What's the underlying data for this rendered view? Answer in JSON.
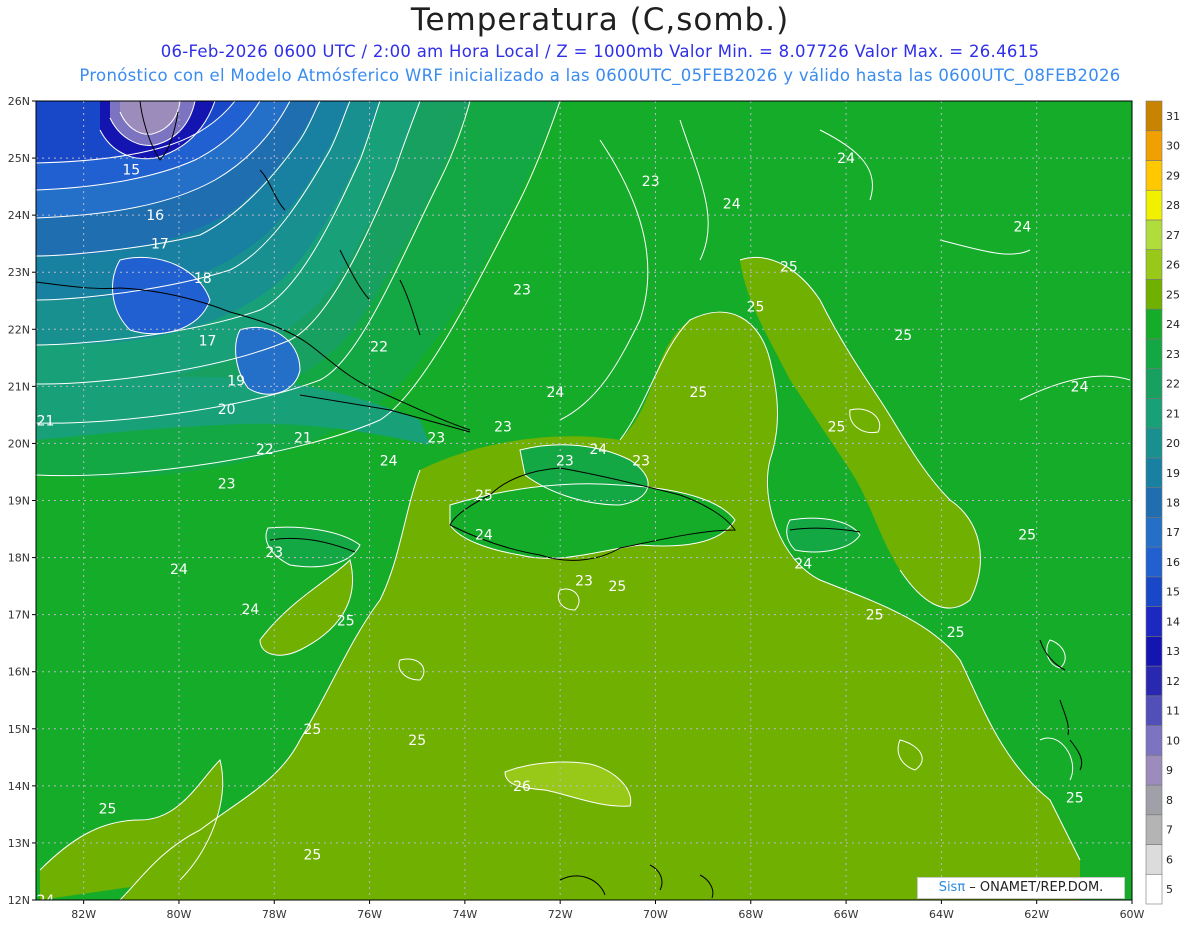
{
  "header": {
    "title": "Temperatura (C,somb.)",
    "subtitle1": "06-Feb-2026  0600 UTC / 2:00 am Hora Local / Z = 1000mb    Valor Min. = 8.07726  Valor Max. = 26.4615",
    "subtitle2": "Pronóstico con el Modelo Atmósferico WRF inicializado a las 0600UTC_05FEB2026 y válido hasta las  0600UTC_08FEB2026"
  },
  "credit": {
    "brand": "Sisπ",
    "text": " – ONAMET/REP.DOM."
  },
  "map": {
    "lat_labels": [
      "26N",
      "25N",
      "24N",
      "23N",
      "22N",
      "21N",
      "20N",
      "19N",
      "18N",
      "17N",
      "16N",
      "15N",
      "14N",
      "13N",
      "12N"
    ],
    "lon_labels": [
      "82W",
      "80W",
      "78W",
      "76W",
      "74W",
      "72W",
      "70W",
      "68W",
      "66W",
      "64W",
      "62W",
      "60W"
    ],
    "lat_range": [
      12,
      26
    ],
    "lon_range": [
      -83,
      -60
    ],
    "grid": "dotted"
  },
  "colorbar": {
    "levels": [
      5,
      6,
      7,
      8,
      9,
      10,
      11,
      12,
      13,
      14,
      15,
      16,
      17,
      18,
      19,
      20,
      21,
      22,
      23,
      24,
      25,
      26,
      27,
      28,
      29,
      30,
      31
    ],
    "colors": [
      "#ffffff",
      "#dcdcdc",
      "#b4b4b4",
      "#a0a0a8",
      "#9c8cbc",
      "#7c74c0",
      "#5050b8",
      "#2828b0",
      "#1414b0",
      "#1c28c0",
      "#1848c8",
      "#2060d0",
      "#2470c8",
      "#1e6eb0",
      "#1880a0",
      "#189090",
      "#18a078",
      "#18a060",
      "#14a844",
      "#14ac28",
      "#70b000",
      "#98c818",
      "#b0dc3c",
      "#f0f000",
      "#ffc800",
      "#f0a000",
      "#c88400"
    ]
  },
  "contour_labels": [
    {
      "text": "15",
      "lon": -81.0,
      "lat": 24.8
    },
    {
      "text": "16",
      "lon": -80.5,
      "lat": 24.0
    },
    {
      "text": "17",
      "lon": -80.4,
      "lat": 23.5
    },
    {
      "text": "18",
      "lon": -79.5,
      "lat": 22.9
    },
    {
      "text": "17",
      "lon": -79.4,
      "lat": 21.8
    },
    {
      "text": "19",
      "lon": -78.8,
      "lat": 21.1
    },
    {
      "text": "20",
      "lon": -79.0,
      "lat": 20.6
    },
    {
      "text": "21",
      "lon": -82.8,
      "lat": 20.4
    },
    {
      "text": "22",
      "lon": -78.2,
      "lat": 19.9
    },
    {
      "text": "21",
      "lon": -77.4,
      "lat": 20.1
    },
    {
      "text": "23",
      "lon": -79.0,
      "lat": 19.3
    },
    {
      "text": "24",
      "lon": -80.0,
      "lat": 17.8
    },
    {
      "text": "23",
      "lon": -78.0,
      "lat": 18.1
    },
    {
      "text": "24",
      "lon": -78.5,
      "lat": 17.1
    },
    {
      "text": "25",
      "lon": -76.5,
      "lat": 16.9
    },
    {
      "text": "25",
      "lon": -77.2,
      "lat": 15.0
    },
    {
      "text": "25",
      "lon": -81.5,
      "lat": 13.6
    },
    {
      "text": "25",
      "lon": -77.2,
      "lat": 12.8
    },
    {
      "text": "24",
      "lon": -82.8,
      "lat": 12.0
    },
    {
      "text": "22",
      "lon": -75.8,
      "lat": 21.7
    },
    {
      "text": "24",
      "lon": -75.6,
      "lat": 19.7
    },
    {
      "text": "23",
      "lon": -74.6,
      "lat": 20.1
    },
    {
      "text": "23",
      "lon": -73.2,
      "lat": 20.3
    },
    {
      "text": "24",
      "lon": -72.1,
      "lat": 20.9
    },
    {
      "text": "23",
      "lon": -71.9,
      "lat": 19.7
    },
    {
      "text": "24",
      "lon": -71.2,
      "lat": 19.9
    },
    {
      "text": "23",
      "lon": -70.3,
      "lat": 19.7
    },
    {
      "text": "25",
      "lon": -73.6,
      "lat": 19.1
    },
    {
      "text": "24",
      "lon": -73.6,
      "lat": 18.4
    },
    {
      "text": "23",
      "lon": -71.5,
      "lat": 17.6
    },
    {
      "text": "25",
      "lon": -70.8,
      "lat": 17.5
    },
    {
      "text": "23",
      "lon": -72.8,
      "lat": 22.7
    },
    {
      "text": "23",
      "lon": -70.1,
      "lat": 24.6
    },
    {
      "text": "24",
      "lon": -68.4,
      "lat": 24.2
    },
    {
      "text": "25",
      "lon": -67.2,
      "lat": 23.1
    },
    {
      "text": "25",
      "lon": -67.9,
      "lat": 22.4
    },
    {
      "text": "25",
      "lon": -64.8,
      "lat": 21.9
    },
    {
      "text": "25",
      "lon": -69.1,
      "lat": 20.9
    },
    {
      "text": "25",
      "lon": -66.2,
      "lat": 20.3
    },
    {
      "text": "24",
      "lon": -66.0,
      "lat": 25.0
    },
    {
      "text": "24",
      "lon": -62.3,
      "lat": 23.8
    },
    {
      "text": "24",
      "lon": -61.1,
      "lat": 21.0
    },
    {
      "text": "24",
      "lon": -66.9,
      "lat": 17.9
    },
    {
      "text": "25",
      "lon": -65.4,
      "lat": 17.0
    },
    {
      "text": "25",
      "lon": -62.2,
      "lat": 18.4
    },
    {
      "text": "25",
      "lon": -63.7,
      "lat": 16.7
    },
    {
      "text": "26",
      "lon": -72.8,
      "lat": 14.0
    },
    {
      "text": "25",
      "lon": -61.2,
      "lat": 13.8
    },
    {
      "text": "25",
      "lon": -75.0,
      "lat": 14.8
    }
  ]
}
